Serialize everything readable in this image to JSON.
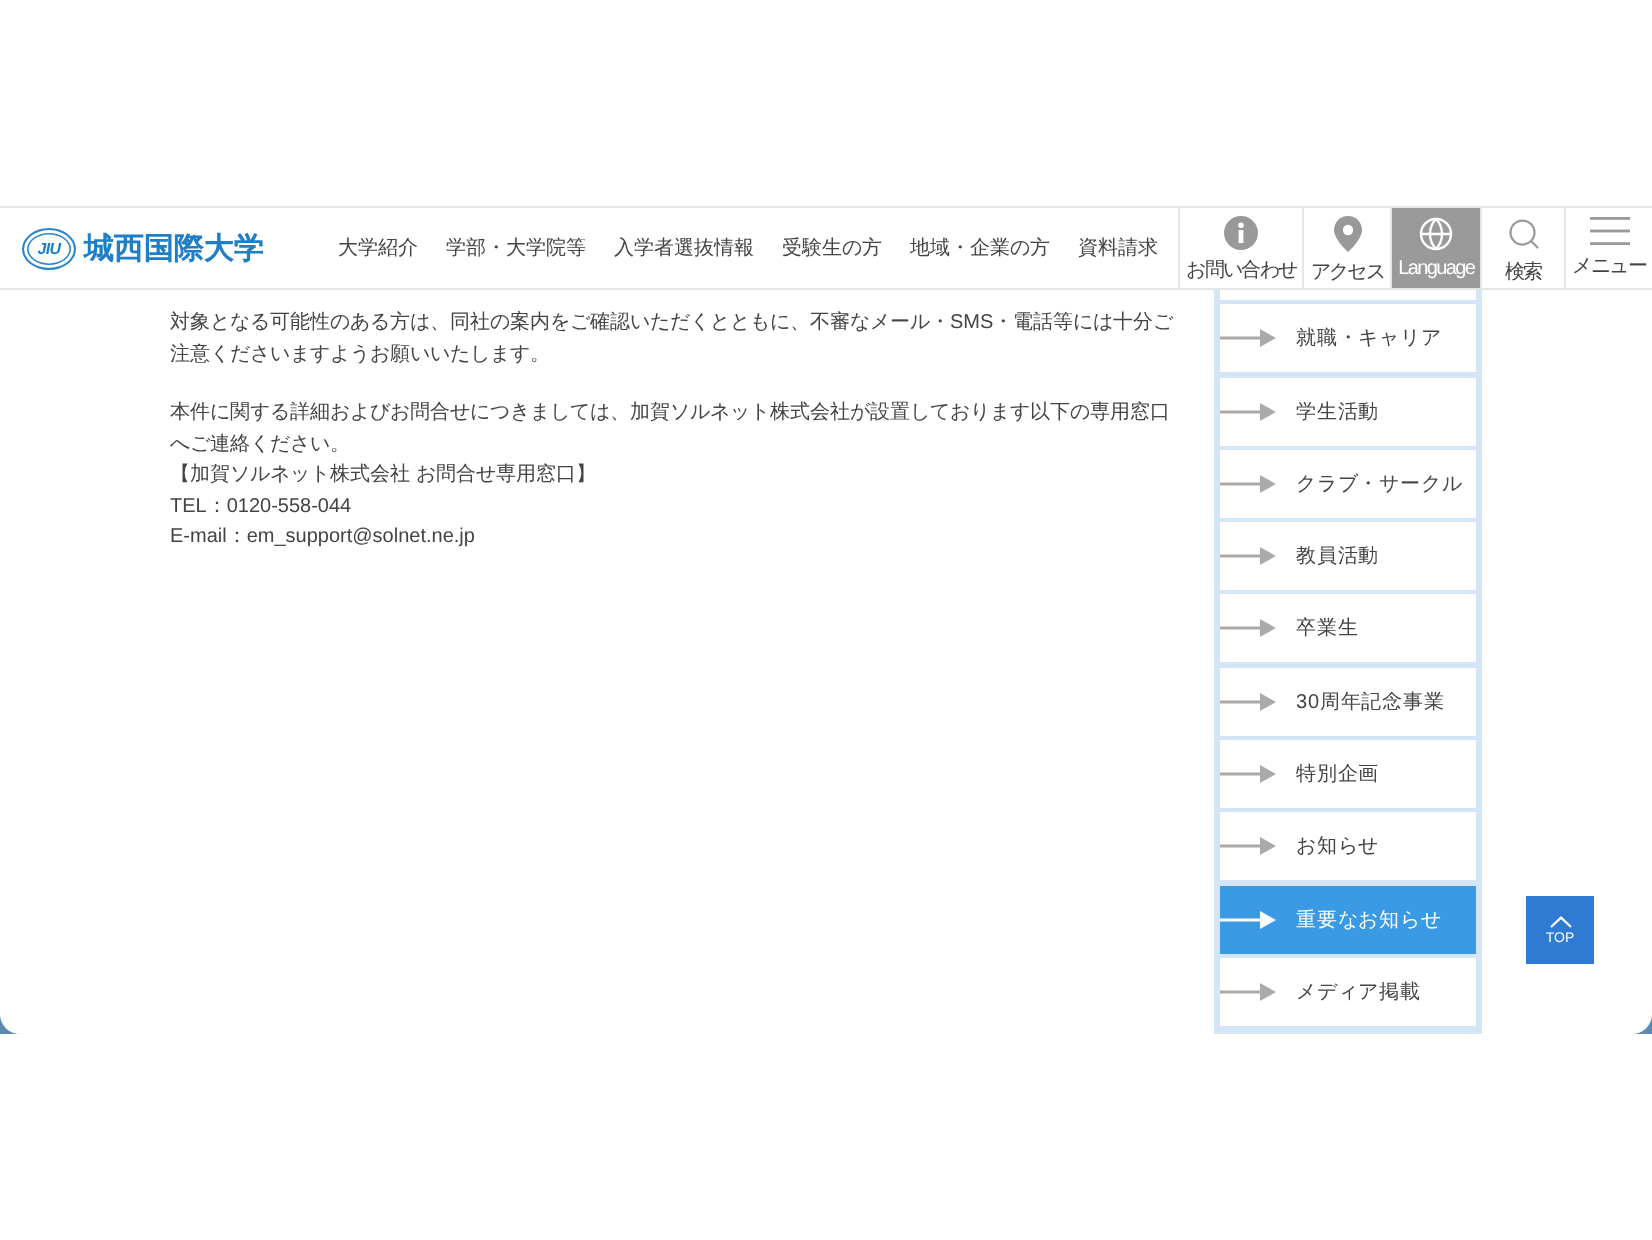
{
  "logo": {
    "mark": "JIU",
    "name": "城西国際大学"
  },
  "nav": [
    "大学紹介",
    "学部・大学院等",
    "入学者選抜情報",
    "受験生の方",
    "地域・企業の方",
    "資料請求"
  ],
  "header_buttons": [
    {
      "kind": "info",
      "label": "お問い合わせ",
      "selected": false
    },
    {
      "kind": "pin",
      "label": "アクセス",
      "selected": false
    },
    {
      "kind": "globe",
      "label": "Language",
      "selected": true
    },
    {
      "kind": "search",
      "label": "検索",
      "selected": false
    },
    {
      "kind": "menu",
      "label": "メニュー",
      "selected": false
    }
  ],
  "article": {
    "groups": [
      [
        "対象となる可能性のある方は、同社の案内をご確認いただくとともに、不審なメール・SMS・電話等には十分ご注意くださいますようお願いいたします。"
      ],
      [
        "本件に関する詳細およびお問合せにつきましては、加賀ソルネット株式会社が設置しております以下の専用窓口へご連絡ください。",
        "【加賀ソルネット株式会社 お問合せ専用窓口】",
        "TEL：0120-558-044",
        "E-mail：em_support@solnet.ne.jp"
      ]
    ]
  },
  "side_menu": [
    {
      "label": "就職・キャリア",
      "selected": false
    },
    {
      "label": "学生活動",
      "selected": false
    },
    {
      "label": "クラブ・サークル",
      "selected": false
    },
    {
      "label": "教員活動",
      "selected": false
    },
    {
      "label": "卒業生",
      "selected": false
    },
    {
      "label": "30周年記念事業",
      "selected": false
    },
    {
      "label": "特別企画",
      "selected": false
    },
    {
      "label": "お知らせ",
      "selected": false
    },
    {
      "label": "重要なお知らせ",
      "selected": true
    },
    {
      "label": "メディア掲載",
      "selected": false
    }
  ],
  "top_button": {
    "label": "TOP"
  }
}
